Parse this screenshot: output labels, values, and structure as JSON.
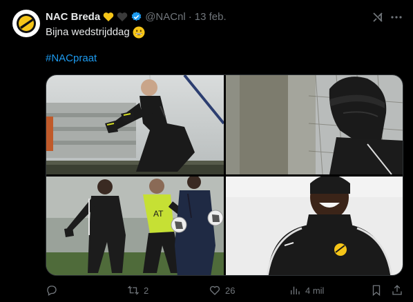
{
  "author": {
    "name": "NAC Breda",
    "handle": "@NACnl",
    "separator": "·",
    "date": "13 feb.",
    "heart_colors": [
      "#f5c518",
      "#3a3a3a"
    ],
    "verified_color": "#1d9bf0"
  },
  "tweet": {
    "text": "Bijna wedstrijddag",
    "emoji": "grinning-face-emoji",
    "hashtag": "#NACpraat"
  },
  "media": {
    "photos": [
      {
        "label": "goalkeeper-training-photo"
      },
      {
        "label": "player-in-balaclava-photo"
      },
      {
        "label": "players-with-balls-photo"
      },
      {
        "label": "smiling-player-photo"
      }
    ]
  },
  "actions": {
    "reply": {
      "count": ""
    },
    "repost": {
      "count": "2"
    },
    "like": {
      "count": "26"
    },
    "views": {
      "count": "4 mil"
    }
  },
  "colors": {
    "background": "#000000",
    "text": "#e7e9ea",
    "muted": "#71767b",
    "link": "#1d9bf0",
    "brand_yellow": "#f5c518"
  }
}
